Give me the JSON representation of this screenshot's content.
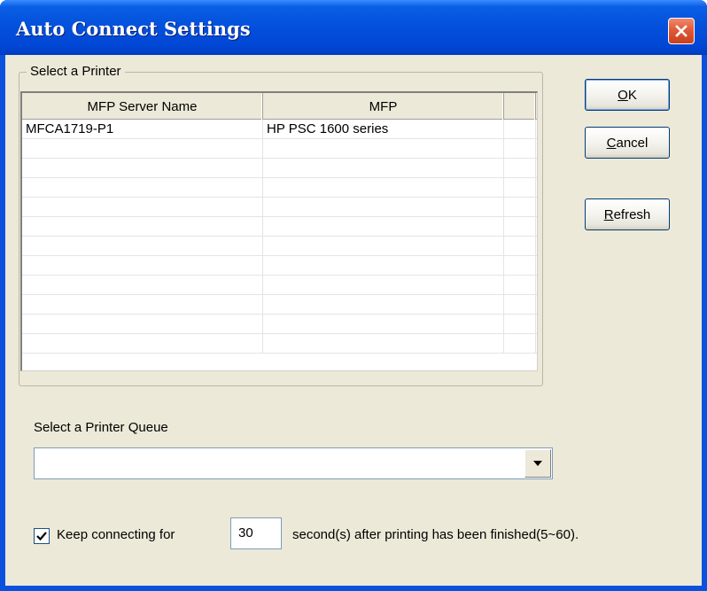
{
  "window": {
    "title": "Auto Connect Settings"
  },
  "printer_group": {
    "label": "Select a Printer",
    "columns": [
      "MFP Server Name",
      "MFP",
      ""
    ],
    "rows": [
      [
        "MFCA1719-P1",
        "HP PSC 1600 series",
        ""
      ],
      [
        "",
        "",
        ""
      ],
      [
        "",
        "",
        ""
      ],
      [
        "",
        "",
        ""
      ],
      [
        "",
        "",
        ""
      ],
      [
        "",
        "",
        ""
      ],
      [
        "",
        "",
        ""
      ],
      [
        "",
        "",
        ""
      ],
      [
        "",
        "",
        ""
      ],
      [
        "",
        "",
        ""
      ],
      [
        "",
        "",
        ""
      ],
      [
        "",
        "",
        ""
      ]
    ]
  },
  "buttons": {
    "ok": {
      "mnemonic": "O",
      "rest": "K"
    },
    "cancel": {
      "mnemonic": "C",
      "rest": "ancel"
    },
    "refresh": {
      "mnemonic": "R",
      "rest": "efresh"
    }
  },
  "queue": {
    "label": "Select a Printer Queue",
    "selected_value": ""
  },
  "keep_connecting": {
    "checked": true,
    "label": "Keep connecting for",
    "seconds_value": "30",
    "suffix": "second(s) after printing has been finished(5~60)."
  },
  "colors": {
    "titlebar": "#0453dd",
    "dialog_face": "#ece9d8",
    "close_button": "#e05a38"
  }
}
